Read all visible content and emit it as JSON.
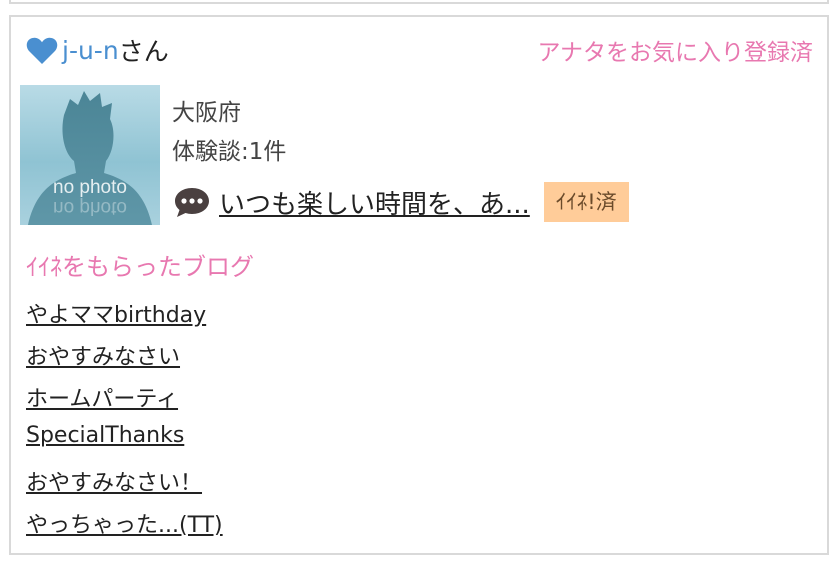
{
  "user": {
    "name": "j-u-n",
    "suffix": "さん",
    "favorite_status": "アナタをお気に入り登録済"
  },
  "avatar": {
    "placeholder_text": "no photo"
  },
  "profile": {
    "prefecture": "大阪府",
    "experience_count": "体験談:1件"
  },
  "review": {
    "title": "いつも楽しい時間を、あ...",
    "iine_badge": "ｲｲﾈ!済"
  },
  "blogs": {
    "heading": "ｲｲﾈをもらったブログ",
    "items": [
      "やよママbirthday",
      "おやすみなさい",
      "ホームパーティ",
      "SpecialThanks",
      "おやすみなさい！",
      "やっちゃった...(TT)"
    ]
  },
  "colors": {
    "accent_pink": "#e878b0",
    "username_blue": "#4a8fd0",
    "heart_blue": "#4a8fd0",
    "badge_bg": "#ffcc99",
    "border": "#d9d9d9"
  },
  "icons": [
    "heart-icon",
    "speech-bubble-icon"
  ]
}
